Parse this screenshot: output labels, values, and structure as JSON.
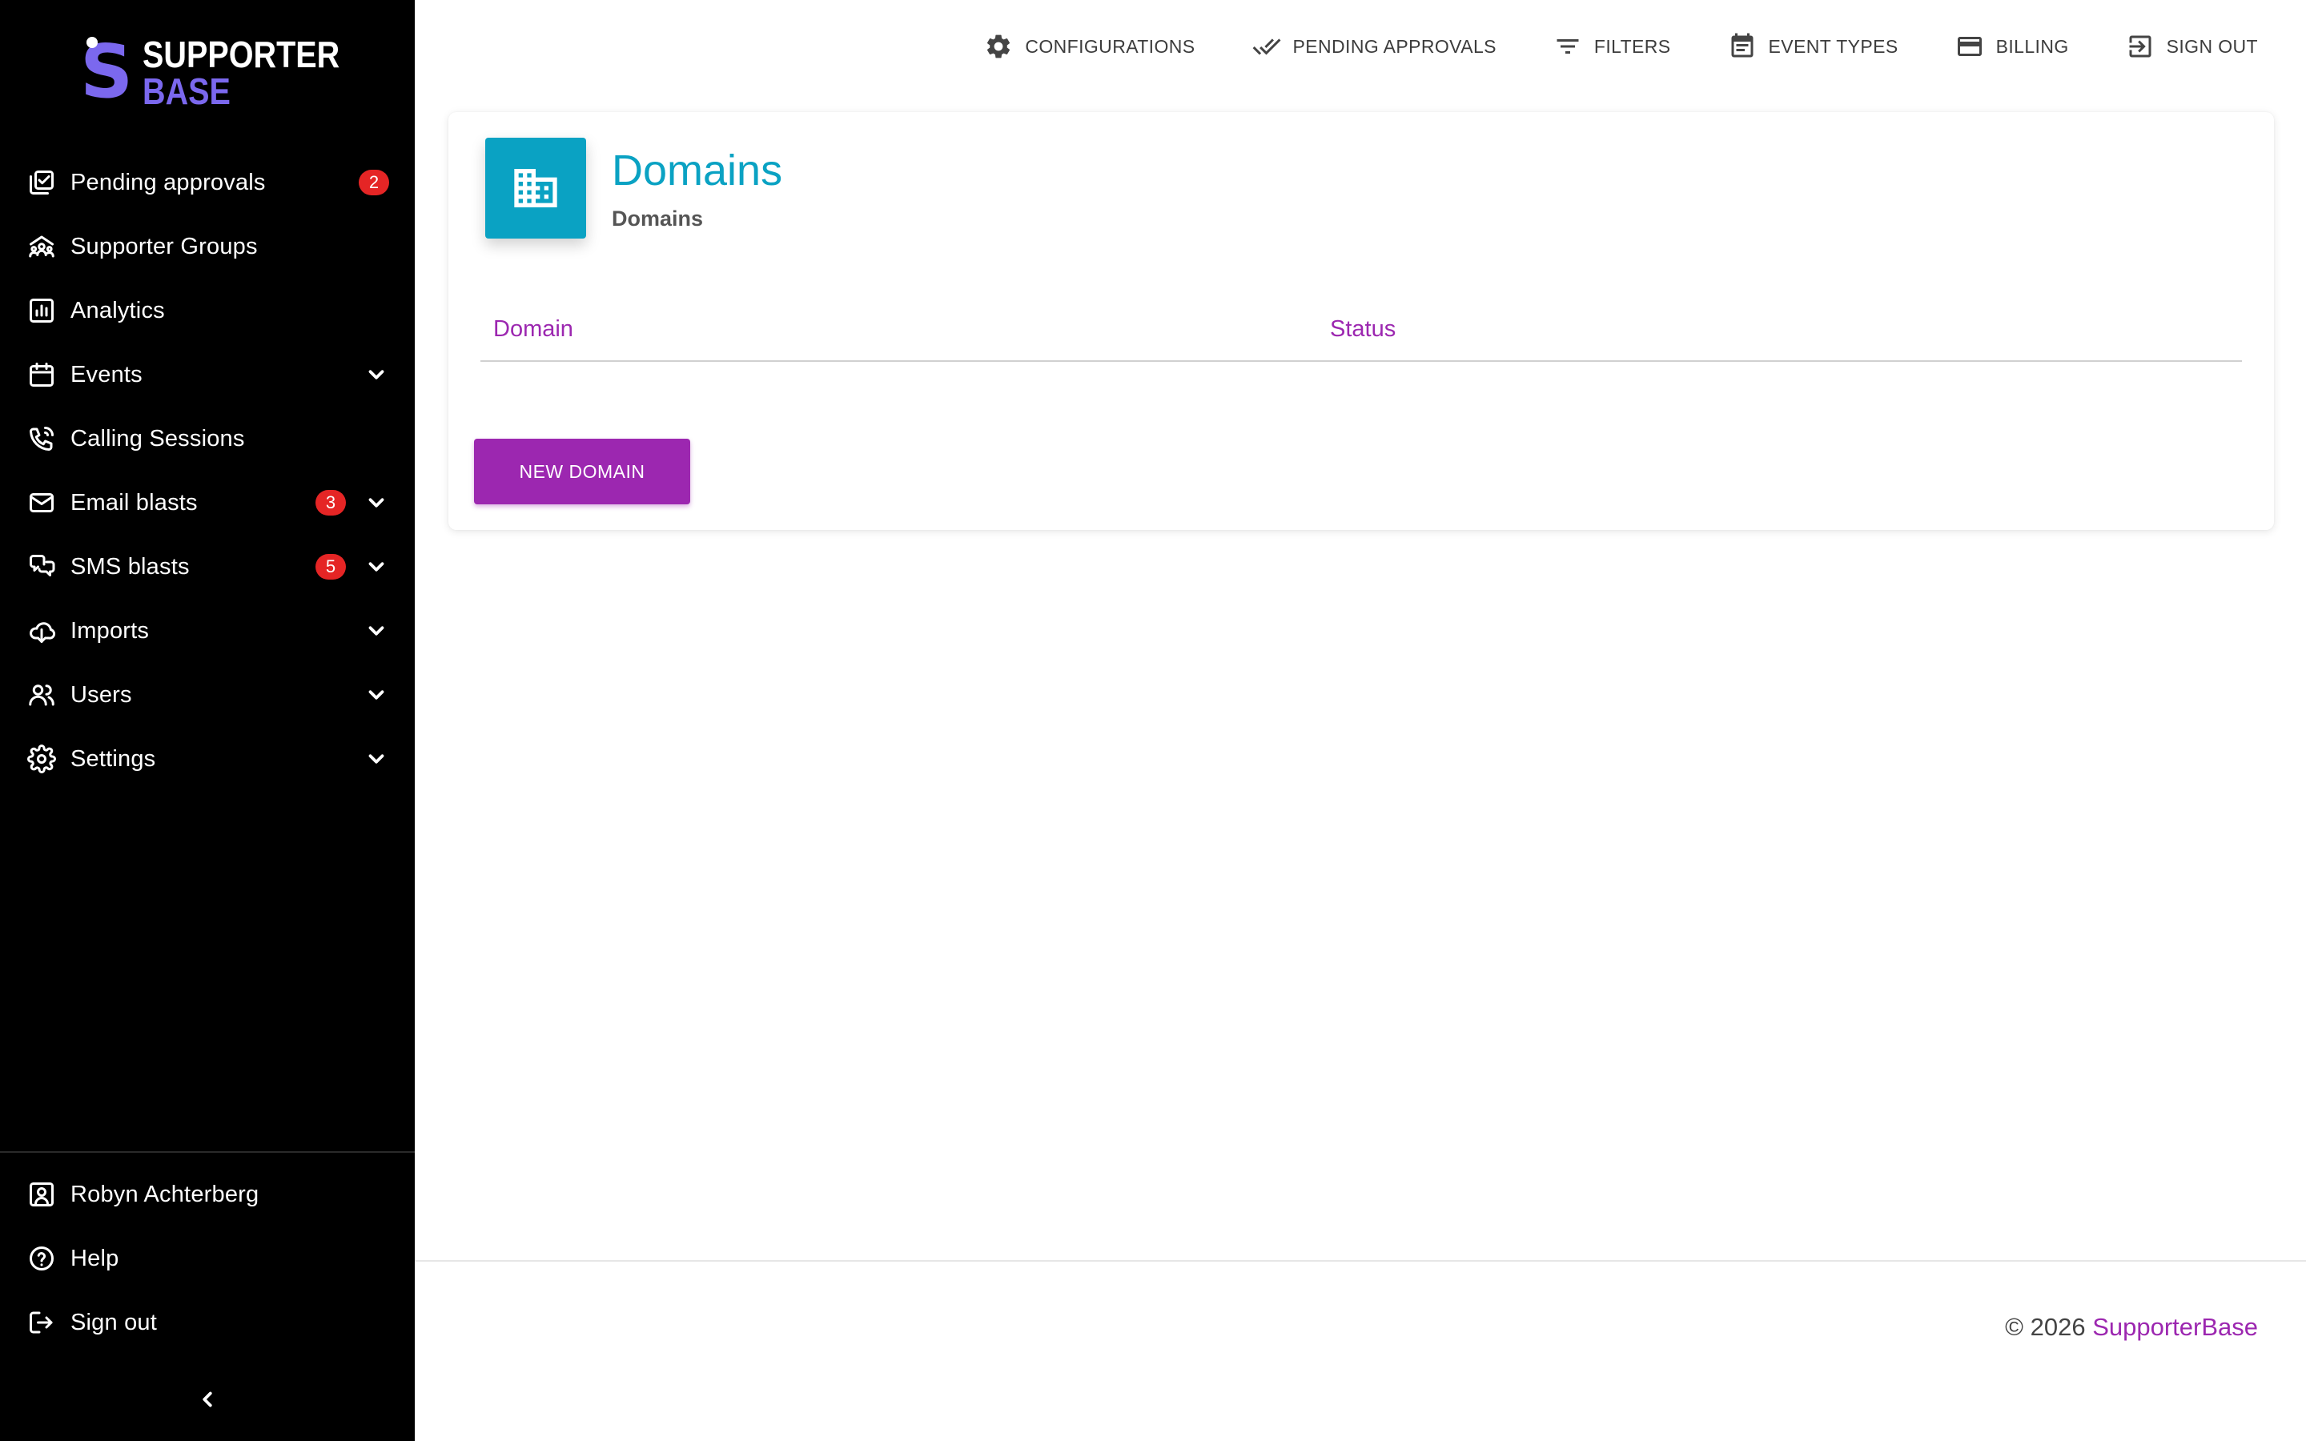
{
  "brand": {
    "name_line1": "SUPPORTER",
    "name_line2": "BASE",
    "mark": "S",
    "accent_color": "#7b68ee"
  },
  "sidebar": {
    "items": [
      {
        "label": "Pending approvals",
        "icon": "check-squares-icon",
        "badge": "2",
        "expandable": false
      },
      {
        "label": "Supporter Groups",
        "icon": "group-icon",
        "badge": null,
        "expandable": false
      },
      {
        "label": "Analytics",
        "icon": "bar-chart-icon",
        "badge": null,
        "expandable": false
      },
      {
        "label": "Events",
        "icon": "calendar-icon",
        "badge": null,
        "expandable": true
      },
      {
        "label": "Calling Sessions",
        "icon": "phone-icon",
        "badge": null,
        "expandable": false
      },
      {
        "label": "Email blasts",
        "icon": "mail-icon",
        "badge": "3",
        "expandable": true
      },
      {
        "label": "SMS blasts",
        "icon": "chat-icon",
        "badge": "5",
        "expandable": true
      },
      {
        "label": "Imports",
        "icon": "cloud-download-icon",
        "badge": null,
        "expandable": true
      },
      {
        "label": "Users",
        "icon": "users-icon",
        "badge": null,
        "expandable": true
      },
      {
        "label": "Settings",
        "icon": "gear-icon",
        "badge": null,
        "expandable": true
      }
    ],
    "bottom_items": [
      {
        "label": "Robyn Achterberg",
        "icon": "user-card-icon"
      },
      {
        "label": "Help",
        "icon": "help-circle-icon"
      },
      {
        "label": "Sign out",
        "icon": "logout-icon"
      }
    ],
    "collapse_icon": "chevron-left-icon"
  },
  "topnav": {
    "items": [
      {
        "label": "CONFIGURATIONS",
        "icon": "gear-icon"
      },
      {
        "label": "PENDING APPROVALS",
        "icon": "double-check-icon"
      },
      {
        "label": "FILTERS",
        "icon": "filter-icon"
      },
      {
        "label": "EVENT TYPES",
        "icon": "event-note-icon"
      },
      {
        "label": "BILLING",
        "icon": "credit-card-icon"
      },
      {
        "label": "SIGN OUT",
        "icon": "exit-icon"
      }
    ]
  },
  "page": {
    "title": "Domains",
    "subtitle": "Domains",
    "header_icon": "building-icon",
    "header_color": "#0aa2c3",
    "table": {
      "columns": [
        "Domain",
        "Status"
      ],
      "rows": []
    },
    "new_button_label": "NEW DOMAIN",
    "primary_color": "#9c27b0"
  },
  "footer": {
    "copyright": "© 2026",
    "link_text": "SupporterBase"
  }
}
